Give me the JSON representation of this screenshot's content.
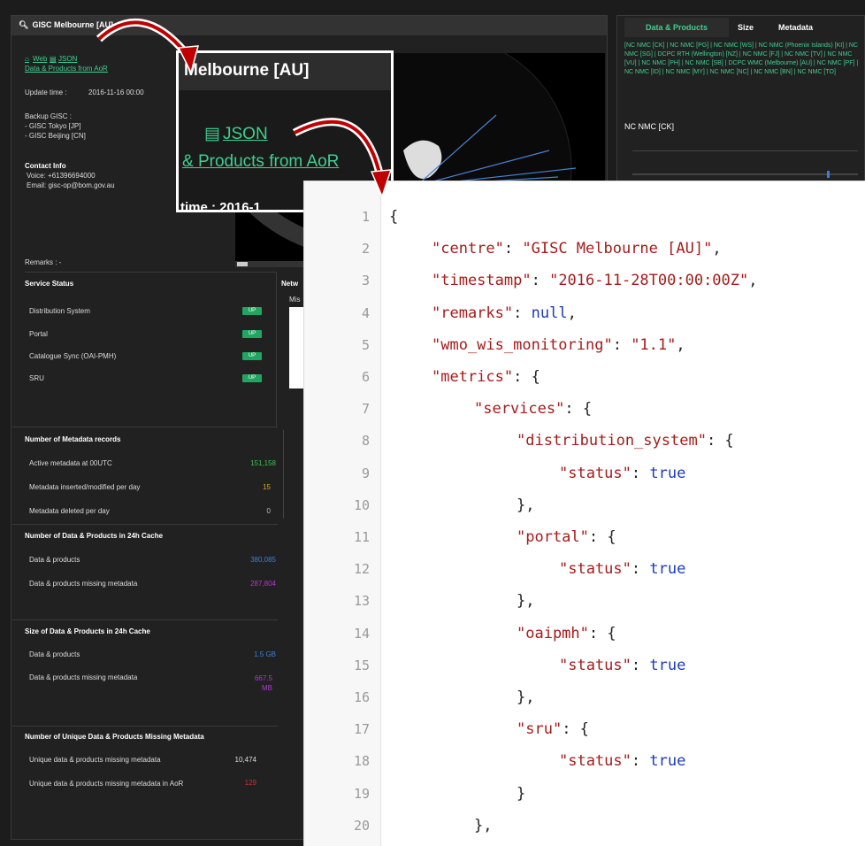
{
  "left": {
    "title": "GISC Melbourne [AU]",
    "links": {
      "web": "Web",
      "json": "JSON",
      "aor": "Data & Products from AoR"
    },
    "update_label": "Update time :",
    "update_value": "2016-11-16 00:00",
    "backup_label": "Backup GISC :",
    "backup_items": [
      "- GISC Tokyo [JP]",
      "- GISC Beijing [CN]"
    ],
    "contact_label": "Contact Info",
    "voice": "Voice: +61396694000",
    "email": "Email: gisc-op@bom.gov.au",
    "remarks": "Remarks : -"
  },
  "service": {
    "title": "Service Status",
    "items": [
      {
        "label": "Distribution System",
        "status": "UP"
      },
      {
        "label": "Portal",
        "status": "UP"
      },
      {
        "label": "Catalogue Sync (OAI-PMH)",
        "status": "UP"
      },
      {
        "label": "SRU",
        "status": "UP"
      }
    ],
    "side_label": "Netw",
    "side_sub": "Mis"
  },
  "metadata_records": {
    "title": "Number of Metadata records",
    "rows": [
      {
        "label": "Active metadata at 00UTC",
        "value": "151,158",
        "color": "#3fbf4f"
      },
      {
        "label": "Metadata inserted/modified per day",
        "value": "15",
        "color": "#e0a030"
      },
      {
        "label": "Metadata deleted per day",
        "value": "0",
        "color": "#bbbbbb"
      }
    ]
  },
  "cache_count": {
    "title": "Number of Data & Products in 24h Cache",
    "rows": [
      {
        "label": "Data & products",
        "value": "380,085",
        "color": "#3a7fd8"
      },
      {
        "label": "Data & products missing metadata",
        "value": "287,804",
        "color": "#b03ad0"
      }
    ]
  },
  "cache_size": {
    "title": "Size of Data & Products in 24h Cache",
    "rows": [
      {
        "label": "Data & products",
        "value": "1.5 GB",
        "color": "#3a7fd8"
      },
      {
        "label": "Data & products missing metadata",
        "value": "667.5 MB",
        "color": "#b03ad0"
      }
    ]
  },
  "unique_missing": {
    "title": "Number of Unique Data & Products Missing Metadata",
    "rows": [
      {
        "label": "Unique data & products missing metadata",
        "value": "10,474",
        "color": "#dddddd"
      },
      {
        "label": "Unique data & products missing metadata in AoR",
        "value": "129",
        "color": "#d03030"
      }
    ]
  },
  "right": {
    "tabs": [
      "Data & Products",
      "Size",
      "Metadata"
    ],
    "list_text": "[NC NMC [CK] | NC NMC [PG] | NC NMC [WS] | NC NMC (Phoenix Islands) [KI] | NC NMC [SG] | DCPC RTH (Wellington) [NZ] | NC NMC [FJ] | NC NMC [TV] | NC NMC [VU] | NC NMC [PH] | NC NMC [SB] | DCPC WMC (Melbourne) [AU] | NC NMC [PF] | NC NMC [ID] | NC NMC [MY] | NC NMC [NC] | NC NMC [BN] | NC NMC [TO]",
    "selected": "NC NMC [CK]"
  },
  "zoom": {
    "title": "Melbourne [AU]",
    "json": "JSON",
    "aor": "& Products from AoR",
    "partial": "time : 2016-1"
  },
  "code": {
    "lines": [
      {
        "n": "1",
        "indent": 0,
        "text": "{"
      },
      {
        "n": "2",
        "indent": 1,
        "key": "\"centre\"",
        "val": "\"GISC Melbourne [AU]\"",
        "vtype": "s",
        "tail": ","
      },
      {
        "n": "3",
        "indent": 1,
        "key": "\"timestamp\"",
        "val": "\"2016-11-28T00:00:00Z\"",
        "vtype": "s",
        "tail": ","
      },
      {
        "n": "4",
        "indent": 1,
        "key": "\"remarks\"",
        "val": "null",
        "vtype": "v",
        "tail": ","
      },
      {
        "n": "5",
        "indent": 1,
        "key": "\"wmo_wis_monitoring\"",
        "val": "\"1.1\"",
        "vtype": "s",
        "tail": ","
      },
      {
        "n": "6",
        "indent": 1,
        "key": "\"metrics\"",
        "val": "{",
        "vtype": "p",
        "tail": ""
      },
      {
        "n": "7",
        "indent": 2,
        "key": "\"services\"",
        "val": "{",
        "vtype": "p",
        "tail": ""
      },
      {
        "n": "8",
        "indent": 3,
        "key": "\"distribution_system\"",
        "val": "{",
        "vtype": "p",
        "tail": ""
      },
      {
        "n": "9",
        "indent": 4,
        "key": "\"status\"",
        "val": "true",
        "vtype": "v",
        "tail": ""
      },
      {
        "n": "10",
        "indent": 3,
        "text": "},"
      },
      {
        "n": "11",
        "indent": 3,
        "key": "\"portal\"",
        "val": "{",
        "vtype": "p",
        "tail": ""
      },
      {
        "n": "12",
        "indent": 4,
        "key": "\"status\"",
        "val": "true",
        "vtype": "v",
        "tail": ""
      },
      {
        "n": "13",
        "indent": 3,
        "text": "},"
      },
      {
        "n": "14",
        "indent": 3,
        "key": "\"oaipmh\"",
        "val": "{",
        "vtype": "p",
        "tail": ""
      },
      {
        "n": "15",
        "indent": 4,
        "key": "\"status\"",
        "val": "true",
        "vtype": "v",
        "tail": ""
      },
      {
        "n": "16",
        "indent": 3,
        "text": "},"
      },
      {
        "n": "17",
        "indent": 3,
        "key": "\"sru\"",
        "val": "{",
        "vtype": "p",
        "tail": ""
      },
      {
        "n": "18",
        "indent": 4,
        "key": "\"status\"",
        "val": "true",
        "vtype": "v",
        "tail": ""
      },
      {
        "n": "19",
        "indent": 3,
        "text": "}"
      },
      {
        "n": "20",
        "indent": 2,
        "text": "},"
      }
    ]
  }
}
